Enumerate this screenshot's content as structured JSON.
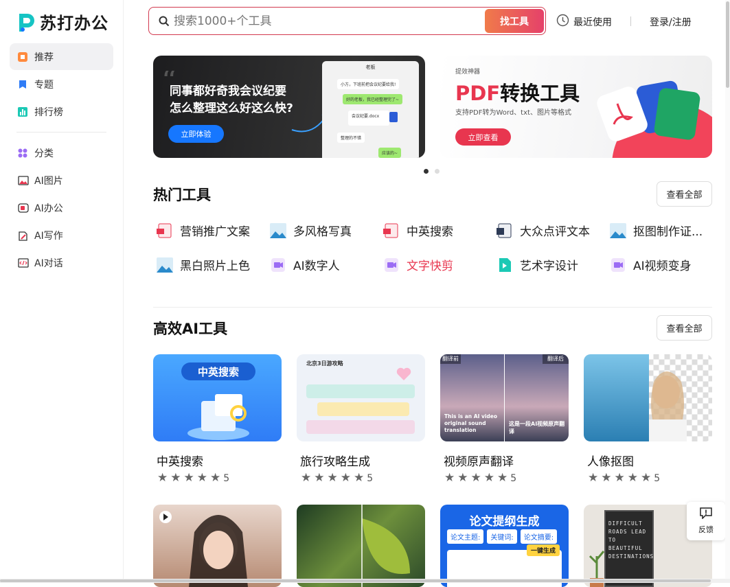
{
  "brand": {
    "name": "苏打办公"
  },
  "sidebar": {
    "items": [
      {
        "label": "推荐",
        "icon": "recommend-icon"
      },
      {
        "label": "专题",
        "icon": "bookmark-icon"
      },
      {
        "label": "排行榜",
        "icon": "ranking-icon"
      },
      {
        "label": "分类",
        "icon": "category-icon"
      },
      {
        "label": "AI图片",
        "icon": "image-icon"
      },
      {
        "label": "AI办公",
        "icon": "office-icon"
      },
      {
        "label": "AI写作",
        "icon": "writing-icon"
      },
      {
        "label": "AI对话",
        "icon": "chat-icon"
      }
    ]
  },
  "header": {
    "search_placeholder": "搜索1000+个工具",
    "search_button": "找工具",
    "recent_label": "最近使用",
    "login_label": "登录/注册"
  },
  "banners": [
    {
      "title_line1": "同事都好奇我会议纪要",
      "title_line2": "怎么整理这么好这么快?",
      "button": "立即体验",
      "chat_title": "老板",
      "chat_msgs": [
        "小方，下班前把会议纪要给我!",
        "好的老板，我已经整理完了~",
        "会议纪要.docx",
        "整理的不错",
        "应该的~"
      ]
    },
    {
      "kicker": "提效神器",
      "title_accent": "PDF",
      "title_rest": "转换工具",
      "subtitle": "支持PDF转为Word、txt、图片等格式",
      "button": "立即查看"
    }
  ],
  "hot_tools": {
    "title": "热门工具",
    "view_all": "查看全部",
    "items": [
      {
        "label": "营销推广文案",
        "icon": "pdf-doc-icon"
      },
      {
        "label": "多风格写真",
        "icon": "photo-icon"
      },
      {
        "label": "中英搜索",
        "icon": "pdf-doc-icon"
      },
      {
        "label": "大众点评文本",
        "icon": "text-doc-icon"
      },
      {
        "label": "抠图制作证...",
        "icon": "photo-icon"
      },
      {
        "label": "黑白照片上色",
        "icon": "photo-icon"
      },
      {
        "label": "AI数字人",
        "icon": "video-icon"
      },
      {
        "label": "文字快剪",
        "icon": "video-icon"
      },
      {
        "label": "艺术字设计",
        "icon": "art-icon"
      },
      {
        "label": "AI视频变身",
        "icon": "video-icon"
      }
    ]
  },
  "ai_tools": {
    "title": "高效AI工具",
    "view_all": "查看全部",
    "cards": [
      {
        "name": "中英搜索",
        "rating": "5",
        "stars": 5,
        "thumb_text": "中英搜索"
      },
      {
        "name": "旅行攻略生成",
        "rating": "5",
        "stars": 5,
        "thumb_text": "北京3日游攻略"
      },
      {
        "name": "视频原声翻译",
        "rating": "5",
        "stars": 5,
        "thumb_left": "翻译前",
        "thumb_right": "翻译后",
        "thumb_en": "This is an AI video original sound translation",
        "thumb_cn": "这是一段AI视频原声翻译"
      },
      {
        "name": "人像抠图",
        "rating": "5",
        "stars": 5
      }
    ],
    "row2": [
      {
        "thumb": "portrait"
      },
      {
        "thumb": "leaf"
      },
      {
        "thumb_text": "论文提纲生成",
        "fields": [
          "论文主题:",
          "关键词:",
          "论文摘要:"
        ],
        "badge": "一键生成"
      },
      {
        "thumb_text": "DIFFICULT ROADS LEAD TO BEAUTIFUL DESTINATIONS"
      }
    ]
  },
  "feedback": {
    "label": "反馈"
  },
  "colors": {
    "accent": "#e8364f",
    "blue": "#1677ff"
  }
}
